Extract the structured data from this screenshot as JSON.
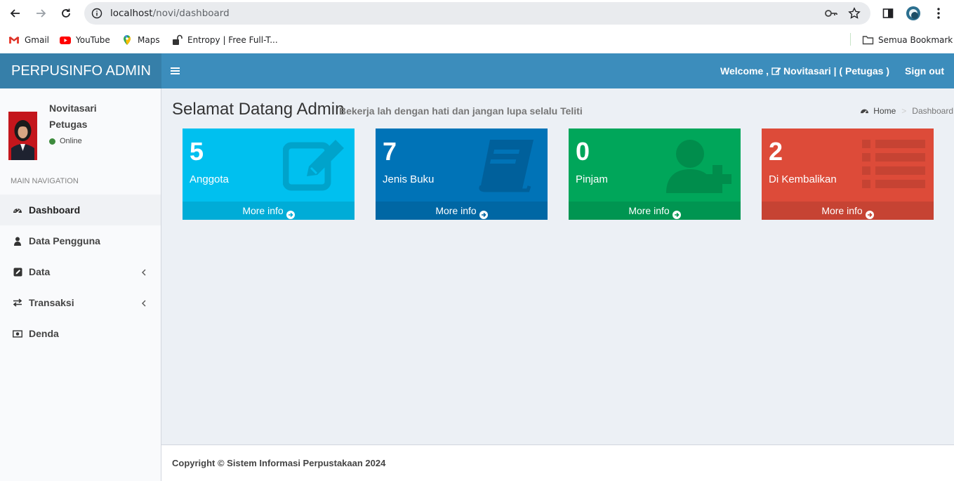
{
  "browser": {
    "url_host": "localhost",
    "url_path": "/novi/dashboard",
    "bookmarks": [
      {
        "label": "Gmail",
        "icon": "gmail-icon"
      },
      {
        "label": "YouTube",
        "icon": "youtube-icon"
      },
      {
        "label": "Maps",
        "icon": "maps-icon"
      },
      {
        "label": "Entropy | Free Full-T...",
        "icon": "lock-open-icon"
      }
    ],
    "all_bookmarks_label": "Semua Bookmark"
  },
  "header": {
    "brand": "PERPUSINFO ADMIN",
    "welcome_prefix": "Welcome ,",
    "welcome_user": "Novitasari | ( Petugas )",
    "signout": "Sign out",
    "color": "#3c8dbc"
  },
  "sidebar": {
    "user_name": "Novitasari",
    "user_role": "Petugas",
    "status": "Online",
    "nav_header": "MAIN NAVIGATION",
    "items": [
      {
        "label": "Dashboard",
        "icon": "dashboard-icon",
        "active": true
      },
      {
        "label": "Data Pengguna",
        "icon": "user-icon"
      },
      {
        "label": "Data",
        "icon": "edit-icon",
        "has_submenu": true
      },
      {
        "label": "Transaksi",
        "icon": "exchange-icon",
        "has_submenu": true
      },
      {
        "label": "Denda",
        "icon": "money-icon"
      }
    ]
  },
  "content": {
    "title": "Selamat Datang Admin",
    "subtitle": "Bekerja lah dengan hati dan jangan lupa selalu Teliti",
    "breadcrumb": {
      "home": "Home",
      "current": "Dashboard"
    },
    "boxes": [
      {
        "count": "5",
        "label": "Anggota",
        "more": "More info",
        "color": "#00c0ef",
        "icon": "edit-icon"
      },
      {
        "count": "7",
        "label": "Jenis Buku",
        "more": "More info",
        "color": "#0073b7",
        "icon": "book-icon"
      },
      {
        "count": "0",
        "label": "Pinjam",
        "more": "More info",
        "color": "#00a65a",
        "icon": "user-plus-icon"
      },
      {
        "count": "2",
        "label": "Di Kembalikan",
        "more": "More info",
        "color": "#dd4b39",
        "icon": "list-icon"
      }
    ]
  },
  "footer": {
    "copyright": "Copyright © Sistem Informasi Perpustakaan 2024"
  }
}
